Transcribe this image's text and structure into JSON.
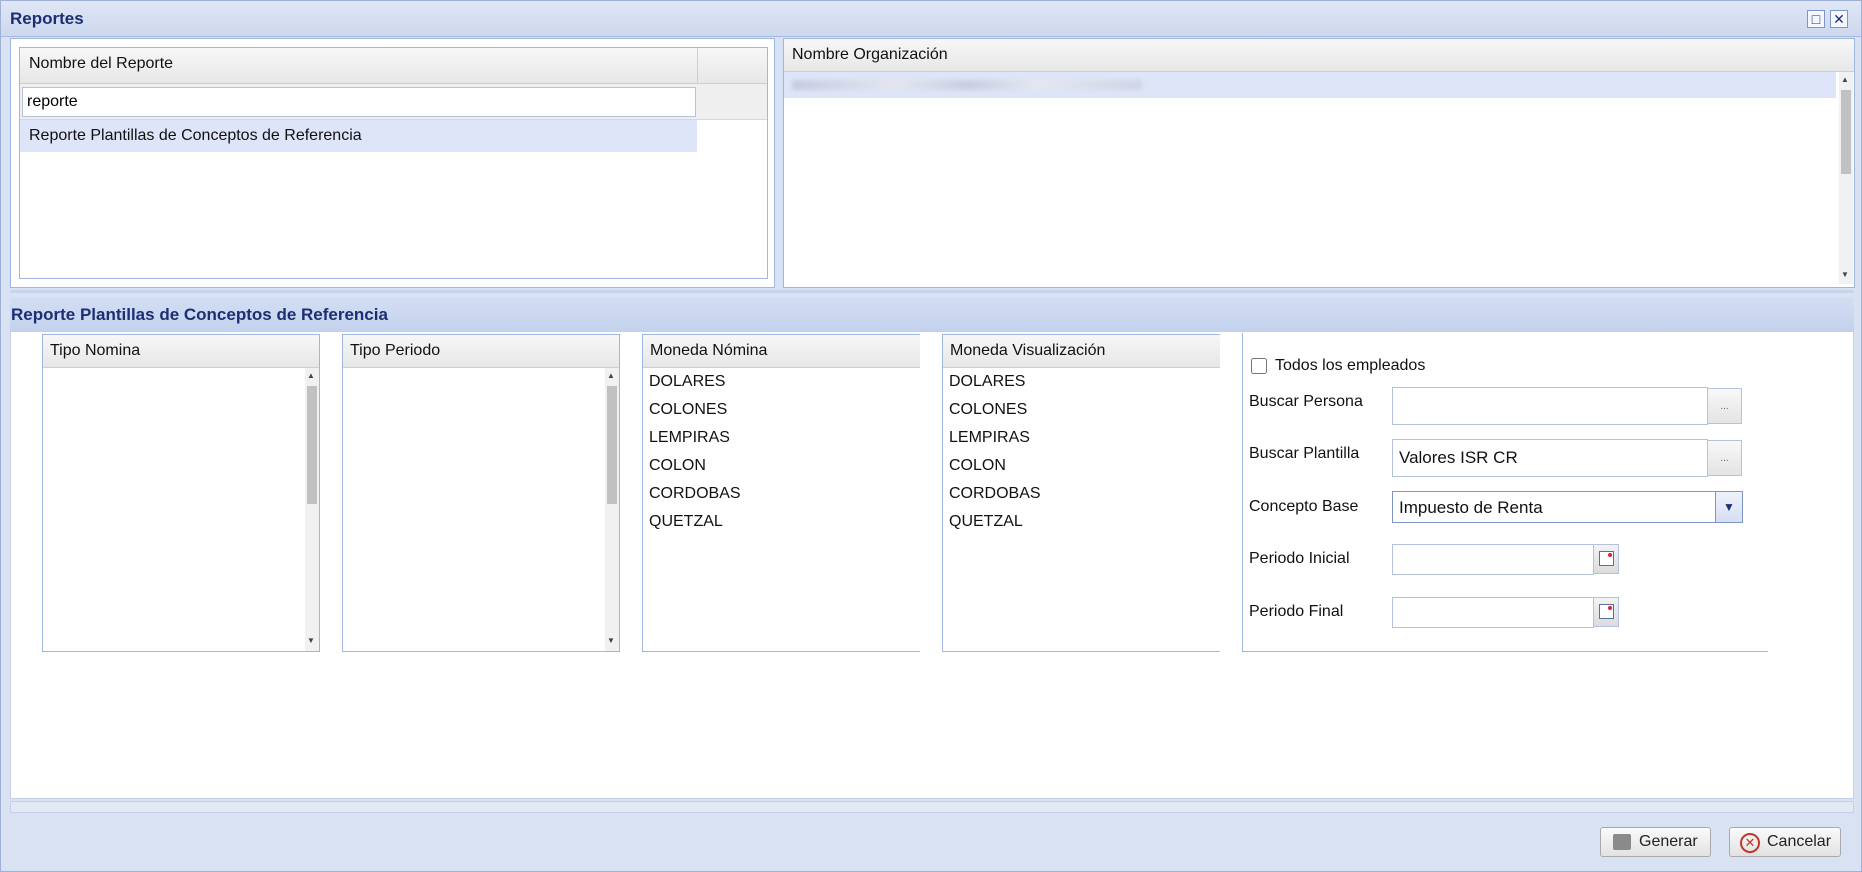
{
  "window": {
    "title": "Reportes"
  },
  "reports": {
    "column_header": "Nombre del Reporte",
    "filter_value": "reporte",
    "rows": [
      "Reporte Plantillas de Conceptos de Referencia"
    ]
  },
  "organizations": {
    "column_header": "Nombre Organización"
  },
  "section": {
    "title": "Reporte Plantillas de Conceptos de Referencia"
  },
  "lists": {
    "tipo_nomina": {
      "header": "Tipo Nomina",
      "items": []
    },
    "tipo_periodo": {
      "header": "Tipo Periodo",
      "items": []
    },
    "moneda_nomina": {
      "header": "Moneda Nómina",
      "items": [
        "DOLARES",
        "COLONES",
        "LEMPIRAS",
        "COLON",
        "CORDOBAS",
        "QUETZAL"
      ]
    },
    "moneda_visualizacion": {
      "header": "Moneda Visualización",
      "items": [
        "DOLARES",
        "COLONES",
        "LEMPIRAS",
        "COLON",
        "CORDOBAS",
        "QUETZAL"
      ]
    }
  },
  "form": {
    "todos_label": "Todos los empleados",
    "buscar_persona_label": "Buscar Persona",
    "buscar_persona_value": "",
    "buscar_plantilla_label": "Buscar Plantilla",
    "buscar_plantilla_value": "Valores ISR CR",
    "concepto_base_label": "Concepto Base",
    "concepto_base_value": "Impuesto de Renta",
    "periodo_inicial_label": "Periodo Inicial",
    "periodo_final_label": "Periodo Final",
    "dots": "..."
  },
  "buttons": {
    "generar": "Generar",
    "cancelar": "Cancelar"
  }
}
